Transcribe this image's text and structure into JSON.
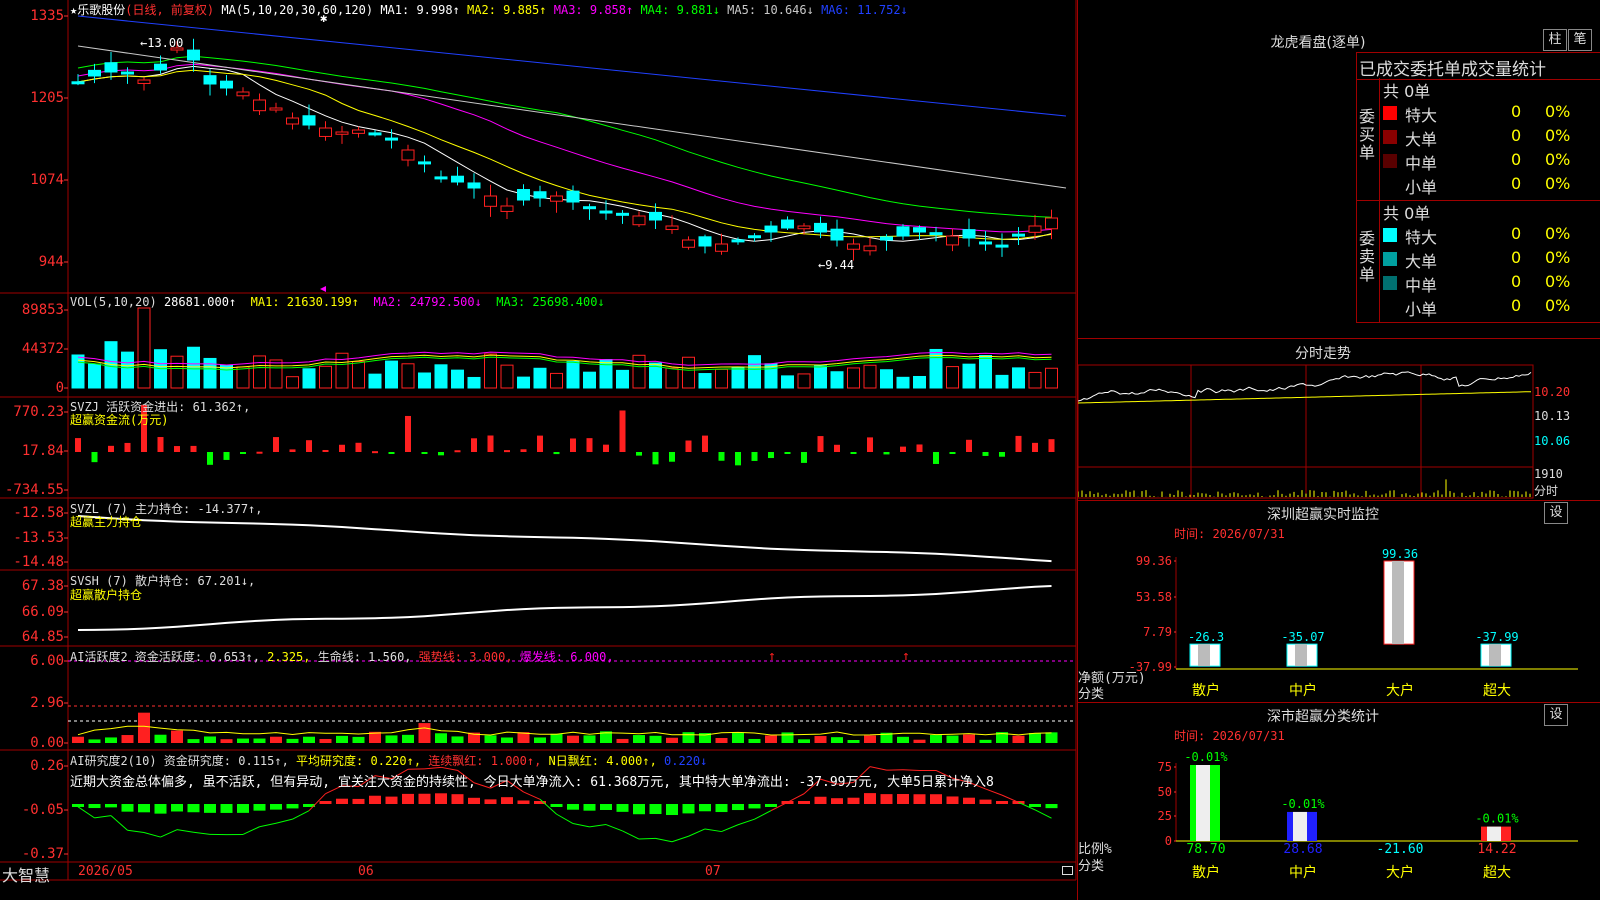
{
  "colors": {
    "up": "#ff2020",
    "down": "#00ffff",
    "ma1": "#ffffff",
    "ma2": "#ffff00",
    "ma3": "#ff00ff",
    "ma4": "#00ff00",
    "ma5": "#c8c8c8",
    "ma6": "#2040ff",
    "frame": "#a00000",
    "axis": "#ff3030"
  },
  "footer": {
    "brand": "大智慧",
    "date_labels": [
      "2026/05",
      "06",
      "07"
    ]
  },
  "main": {
    "title_prefix": "★乐歌股份",
    "title_mode": "(日线, 前复权)",
    "ma_label": "MA(5,10,20,30,60,120)",
    "ma_values": [
      {
        "text": "MA1: 9.998↑",
        "color": "#ffffff"
      },
      {
        "text": "MA2: 9.885↑",
        "color": "#ffff00"
      },
      {
        "text": "MA3: 9.858↑",
        "color": "#ff00ff"
      },
      {
        "text": "MA4: 9.881↓",
        "color": "#00ff00"
      },
      {
        "text": "MA5: 10.646↓",
        "color": "#c8c8c8"
      },
      {
        "text": "MA6: 11.752↓",
        "color": "#2040ff"
      }
    ],
    "price_ticks": [
      "1335",
      "1205",
      "1074",
      "944"
    ],
    "high_note": "←13.00",
    "low_note": "←9.44"
  },
  "vol": {
    "label": "VOL(5,10,20)",
    "value": "28681.000↑",
    "ma1": "MA1: 21630.199↑",
    "ma2": "MA2: 24792.500↓",
    "ma3": "MA3: 25698.400↓",
    "ticks": [
      "89853",
      "44372",
      "0"
    ]
  },
  "svzj": {
    "label": "SVZJ  活跃资金进出: 61.362↑,",
    "sub": "超赢资金流(万元)",
    "ticks": [
      "770.23",
      "17.84",
      "-734.55"
    ]
  },
  "svzl": {
    "label": "SVZL (7) 主力持仓: -14.377↑,",
    "sub": "超赢主力持仓",
    "ticks": [
      "-12.58",
      "-13.53",
      "-14.48"
    ]
  },
  "svsh": {
    "label": "SVSH (7) 散户持仓: 67.201↓,",
    "sub": "超赢散户持仓",
    "ticks": [
      "67.38",
      "66.09",
      "64.85"
    ]
  },
  "ai1": {
    "parts": [
      {
        "text": "AI活跃度2 资金活跃度: 0.653↑, ",
        "color": "#dddddd"
      },
      {
        "text": "2.325, ",
        "color": "#ffff00"
      },
      {
        "text": "生命线: 1.560, ",
        "color": "#dddddd"
      },
      {
        "text": "强势线: 3.000, ",
        "color": "#ff3030"
      },
      {
        "text": "爆发线: 6.000,",
        "color": "#ff00ff"
      }
    ],
    "ticks": [
      "6.00",
      "2.96",
      "0.00"
    ]
  },
  "ai2": {
    "parts": [
      {
        "text": "AI研究度2(10) 资金研究度: 0.115↑, ",
        "color": "#dddddd"
      },
      {
        "text": "平均研究度: 0.220↑, ",
        "color": "#ffff00"
      },
      {
        "text": "连续飘红: 1.000↑, ",
        "color": "#ff3030"
      },
      {
        "text": "N日飘红: 4.000↑, ",
        "color": "#ffff00"
      },
      {
        "text": "0.220↓",
        "color": "#2040ff"
      }
    ],
    "comment": "近期大资金总体偏多, 虽不活跃, 但有异动, 宜关注大资金的持续性, 今日大单净流入: 61.368万元, 其中特大单净流出: -37.99万元, 大单5日累计净入8",
    "ticks": [
      "0.26",
      "-0.05",
      "-0.37"
    ]
  },
  "dragon": {
    "title": "龙虎看盘(逐单)",
    "btn1": "柱",
    "btn2": "笔",
    "header": "已成交委托单成交量统计",
    "buy_label": "委买单",
    "sell_label": "委卖单",
    "buy_total": "共 0单",
    "sell_total": "共 0单",
    "buy_rows": [
      {
        "name": "特大",
        "count": "0",
        "pct": "0%",
        "color": "#ff0000"
      },
      {
        "name": "大单",
        "count": "0",
        "pct": "0%",
        "color": "#8a0000"
      },
      {
        "name": "中单",
        "count": "0",
        "pct": "0%",
        "color": "#5a0000"
      },
      {
        "name": "小单",
        "count": "0",
        "pct": "0%",
        "color": "#000000"
      }
    ],
    "sell_rows": [
      {
        "name": "特大",
        "count": "0",
        "pct": "0%",
        "color": "#00ffff"
      },
      {
        "name": "大单",
        "count": "0",
        "pct": "0%",
        "color": "#00a0a0"
      },
      {
        "name": "中单",
        "count": "0",
        "pct": "0%",
        "color": "#007070"
      },
      {
        "name": "小单",
        "count": "0",
        "pct": "0%",
        "color": "#000000"
      }
    ]
  },
  "intraday": {
    "title": "分时走势",
    "price_ticks": [
      "10.20",
      "10.13",
      "10.06"
    ],
    "vol_tick": "1910",
    "vol_unit": "分时"
  },
  "monitor": {
    "title": "深圳超赢实时监控",
    "btn": "设",
    "time": "时间: 2026/07/31",
    "ylabels": [
      "99.36",
      "53.58",
      "7.79",
      "-37.99"
    ],
    "axis_title": "净额(万元)",
    "axis_sub": "分类"
  },
  "stats": {
    "title": "深市超赢分类统计",
    "btn": "设",
    "time": "时间: 2026/07/31",
    "ylabels": [
      "75",
      "50",
      "25",
      "0"
    ],
    "axis_title": "比例%",
    "axis_sub": "分类"
  },
  "chart_data": [
    {
      "type": "bar",
      "title": "深圳超赢实时监控",
      "categories": [
        "散户",
        "中户",
        "大户",
        "超大"
      ],
      "values": [
        -26.3,
        -35.07,
        99.36,
        -37.99
      ],
      "ylim": [
        -37.99,
        99.36
      ],
      "ylabel": "净额(万元)",
      "xlabel": "分类"
    },
    {
      "type": "bar",
      "title": "深市超赢分类统计",
      "categories": [
        "散户",
        "中户",
        "大户",
        "超大"
      ],
      "values": [
        78.7,
        28.68,
        -21.6,
        14.22
      ],
      "top_labels": [
        "-0.01%",
        "-0.01%",
        "",
        "-0.01%"
      ],
      "ylim": [
        0,
        75
      ],
      "ylabel": "比例%",
      "xlabel": "分类"
    }
  ]
}
